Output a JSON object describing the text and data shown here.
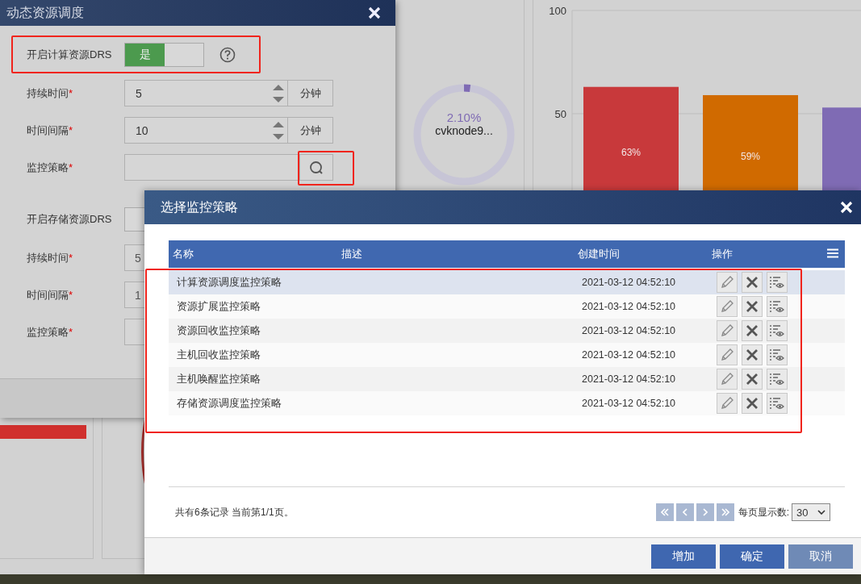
{
  "background": {
    "ring_gauge": {
      "reading": "2.10%",
      "label": "cvknode9...",
      "level": 0.021
    },
    "bar_chart": {
      "chart_data": {
        "type": "bar",
        "values": [
          63,
          59,
          53
        ],
        "colors": [
          "#c8393b",
          "#d06a00",
          "#7f6bb4"
        ],
        "ylim": [
          0,
          100
        ],
        "yticks": [
          50,
          100
        ],
        "value_labels": [
          "63%",
          "59%",
          null
        ]
      }
    }
  },
  "drs_dialog": {
    "title": "动态资源调度",
    "compute_section": {
      "enable_label": "开启计算资源DRS",
      "toggle": {
        "on_label": "是",
        "on": true
      },
      "fields": [
        {
          "kind": "spinner",
          "label": "持续时间",
          "required_mark": "*",
          "value": "5",
          "unit": "分钟"
        },
        {
          "kind": "spinner",
          "label": "时间间隔",
          "required_mark": "*",
          "value": "10",
          "unit": "分钟"
        },
        {
          "kind": "lookup",
          "label": "监控策略",
          "required_mark": "*"
        }
      ]
    },
    "storage_section": {
      "enable_label": "开启存储资源DRS",
      "fields": [
        {
          "kind": "text",
          "label": "持续时间",
          "required_mark": "*",
          "value": "5"
        },
        {
          "kind": "text",
          "label": "时间间隔",
          "required_mark": "*",
          "value": "1"
        },
        {
          "kind": "text",
          "label": "监控策略",
          "required_mark": "*"
        }
      ]
    }
  },
  "policy_dialog": {
    "title": "选择监控策略",
    "table": {
      "columns": [
        "名称",
        "描述",
        "创建时间",
        "操作"
      ],
      "rows": [
        {
          "name": "计算资源调度监控策略",
          "created": "2021-03-12 04:52:10",
          "selected": true
        },
        {
          "name": "资源扩展监控策略",
          "created": "2021-03-12 04:52:10",
          "selected": false
        },
        {
          "name": "资源回收监控策略",
          "created": "2021-03-12 04:52:10",
          "selected": false
        },
        {
          "name": "主机回收监控策略",
          "created": "2021-03-12 04:52:10",
          "selected": false
        },
        {
          "name": "主机唤醒监控策略",
          "created": "2021-03-12 04:52:10",
          "selected": false
        },
        {
          "name": "存储资源调度监控策略",
          "created": "2021-03-12 04:52:10",
          "selected": false
        }
      ]
    },
    "pager": {
      "summary": "共有6条记录 当前第1/1页。",
      "page_size_label": "每页显示数:",
      "page_size": "30"
    },
    "buttons": [
      {
        "label": "增加",
        "primary": true
      },
      {
        "label": "确定",
        "primary": true
      },
      {
        "label": "取消",
        "primary": false
      }
    ]
  }
}
